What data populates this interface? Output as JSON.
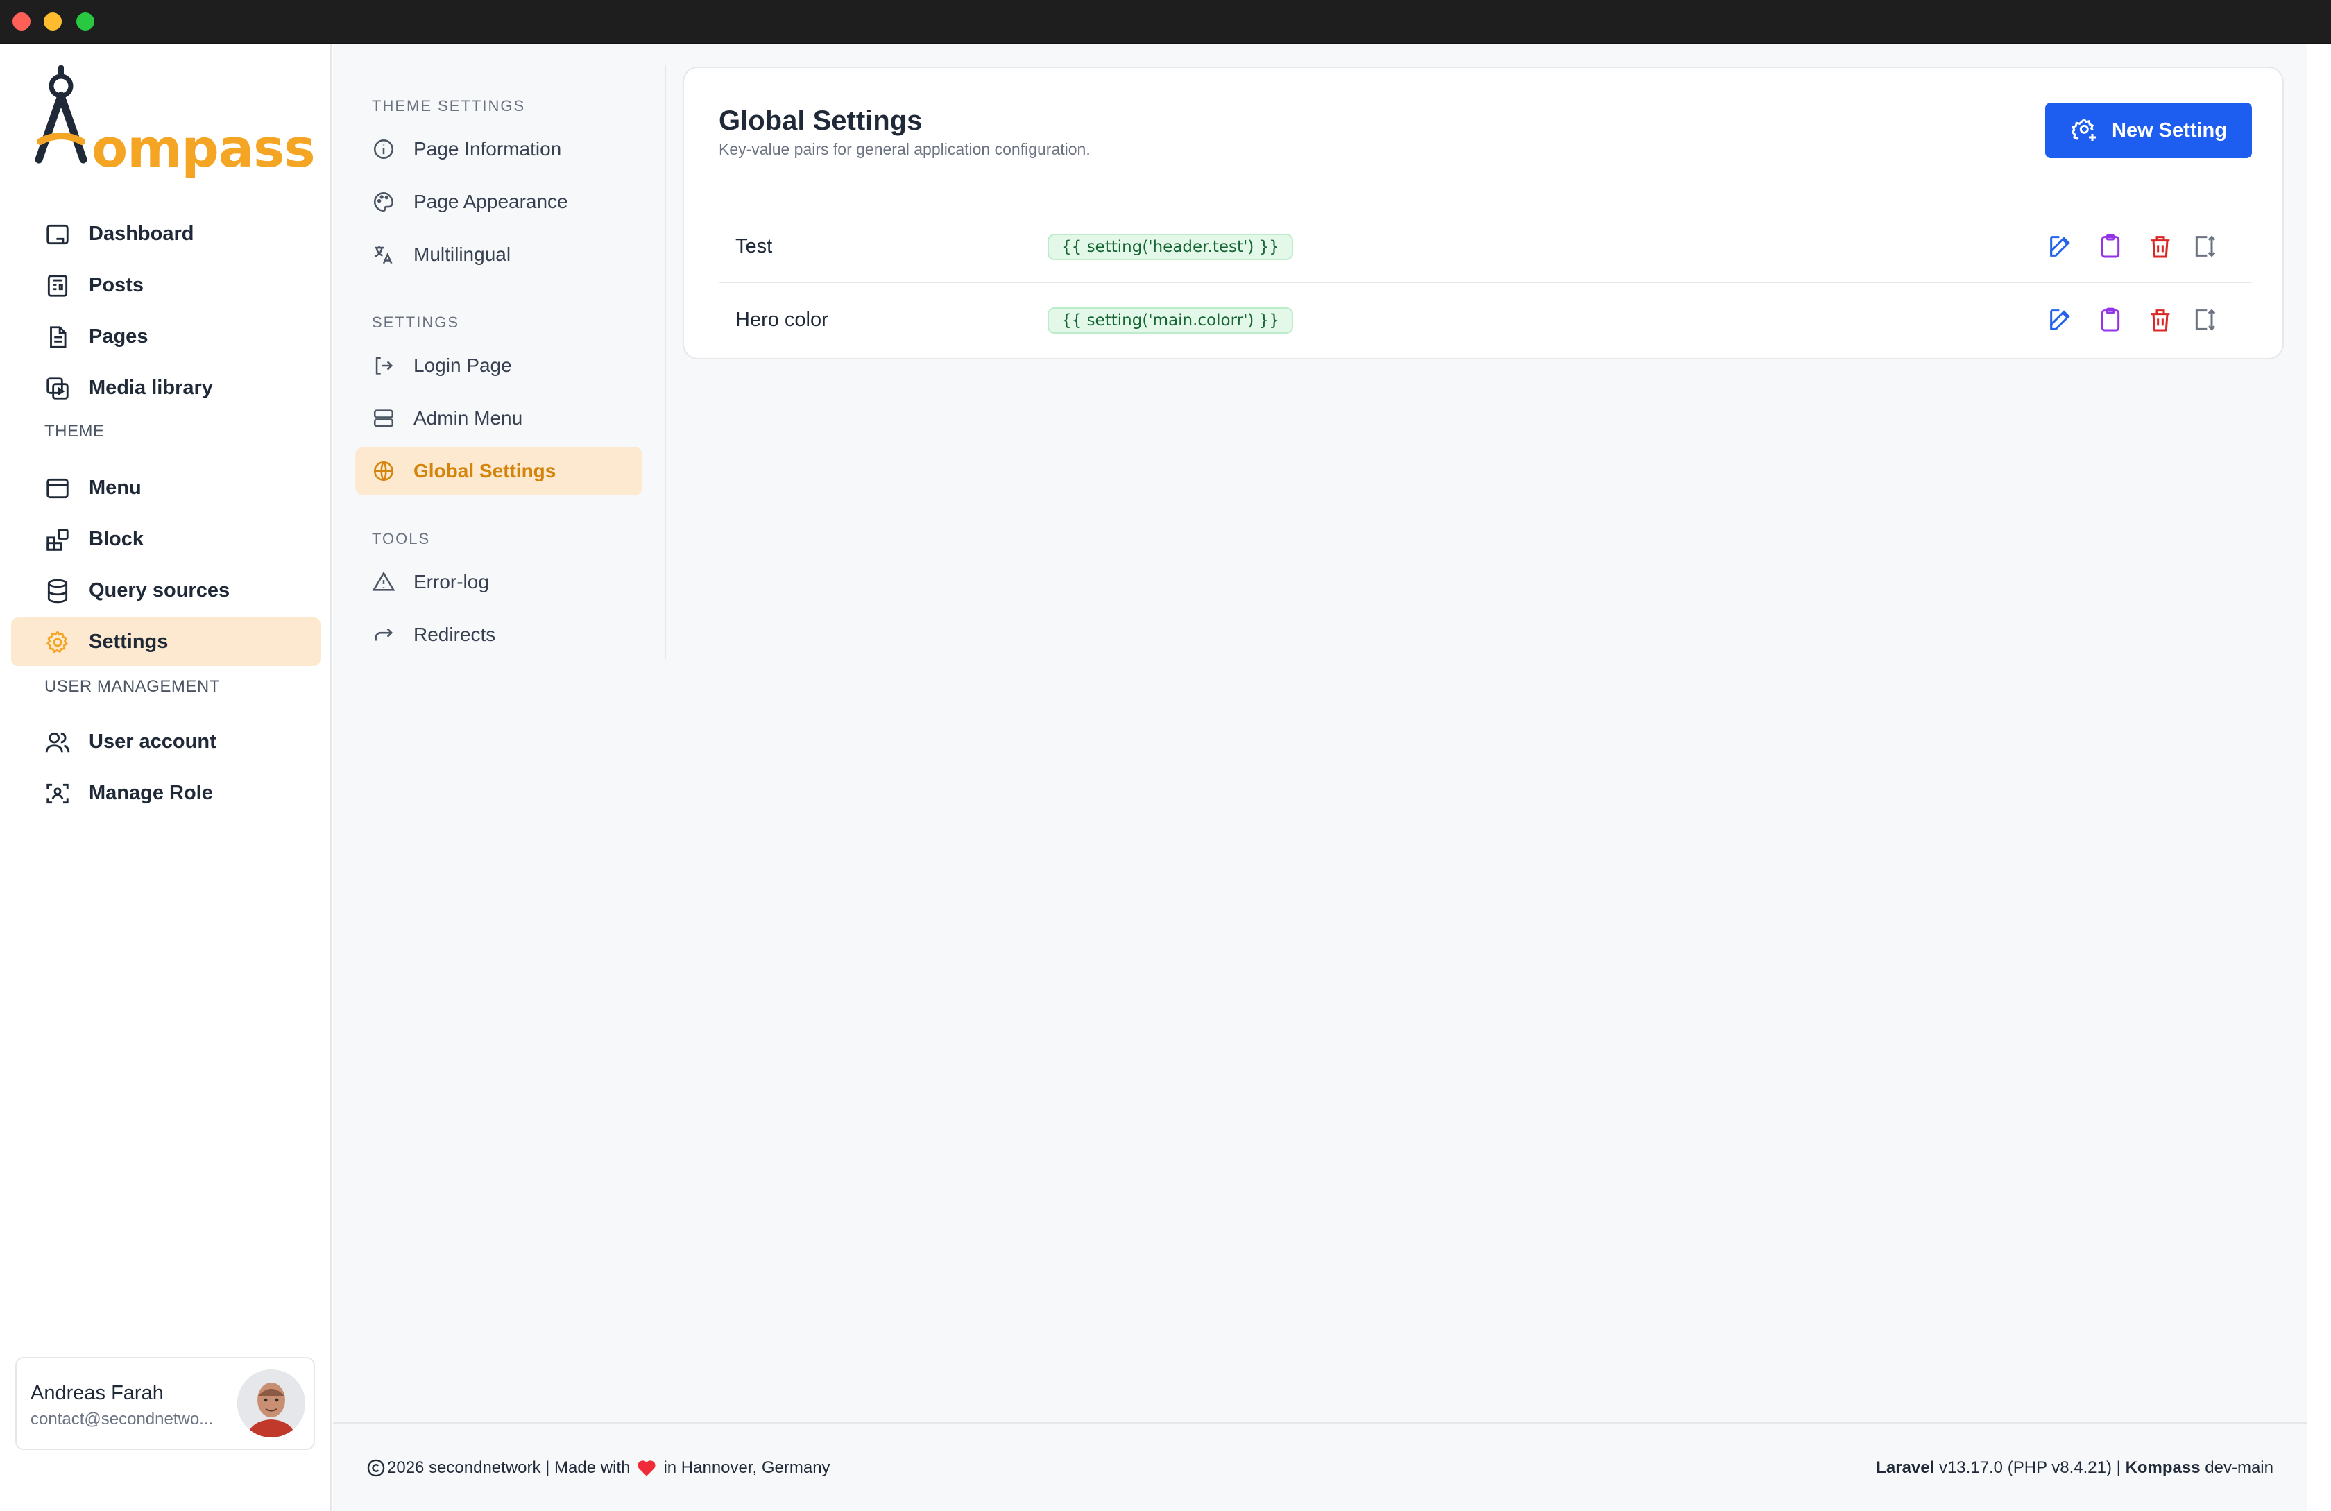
{
  "brand": {
    "name": "Kompass",
    "accent": "#f5a524",
    "primary_button": "#1d5ef0",
    "active_bg": "#fde9cf",
    "logo_text": "ompass"
  },
  "sidebar": {
    "items": [
      {
        "label": "Dashboard",
        "icon": "dashboard-icon"
      },
      {
        "label": "Posts",
        "icon": "posts-icon"
      },
      {
        "label": "Pages",
        "icon": "pages-icon"
      },
      {
        "label": "Media library",
        "icon": "media-library-icon"
      }
    ],
    "theme_title": "THEME",
    "theme_items": [
      {
        "label": "Menu",
        "icon": "menu-icon"
      },
      {
        "label": "Block",
        "icon": "block-icon"
      },
      {
        "label": "Query sources",
        "icon": "database-icon"
      },
      {
        "label": "Settings",
        "icon": "gear-icon",
        "active": true
      }
    ],
    "user_mgmt_title": "USER MANAGEMENT",
    "user_items": [
      {
        "label": "User account",
        "icon": "users-icon"
      },
      {
        "label": "Manage Role",
        "icon": "role-icon"
      }
    ],
    "user": {
      "name": "Andreas Farah",
      "email": "contact@secondnetwo..."
    }
  },
  "subnav": {
    "theme_settings_title": "THEME SETTINGS",
    "theme_settings": [
      {
        "label": "Page Information",
        "icon": "info-icon"
      },
      {
        "label": "Page Appearance",
        "icon": "palette-icon"
      },
      {
        "label": "Multilingual",
        "icon": "translate-icon"
      }
    ],
    "settings_title": "SETTINGS",
    "settings": [
      {
        "label": "Login Page",
        "icon": "login-icon"
      },
      {
        "label": "Admin Menu",
        "icon": "admin-menu-icon"
      },
      {
        "label": "Global Settings",
        "icon": "globe-icon",
        "active": true
      }
    ],
    "tools_title": "TOOLS",
    "tools": [
      {
        "label": "Error-log",
        "icon": "warning-icon"
      },
      {
        "label": "Redirects",
        "icon": "redirect-icon"
      }
    ]
  },
  "main": {
    "title": "Global Settings",
    "subtitle": "Key-value pairs for general application configuration.",
    "new_button": "New Setting",
    "rows": [
      {
        "key": "Test",
        "code": "{{ setting('header.test') }}"
      },
      {
        "key": "Hero color",
        "code": "{{ setting('main.colorr') }}"
      }
    ],
    "row_actions": [
      "edit-icon",
      "clipboard-icon",
      "trash-icon",
      "move-icon"
    ]
  },
  "footer": {
    "left_pre": "2026 secondnetwork | Made with",
    "left_post": "in Hannover, Germany",
    "laravel_label": "Laravel",
    "laravel_version": "v13.17.0 (PHP v8.4.21) |",
    "kompass_label": "Kompass",
    "kompass_version": "dev-main"
  }
}
